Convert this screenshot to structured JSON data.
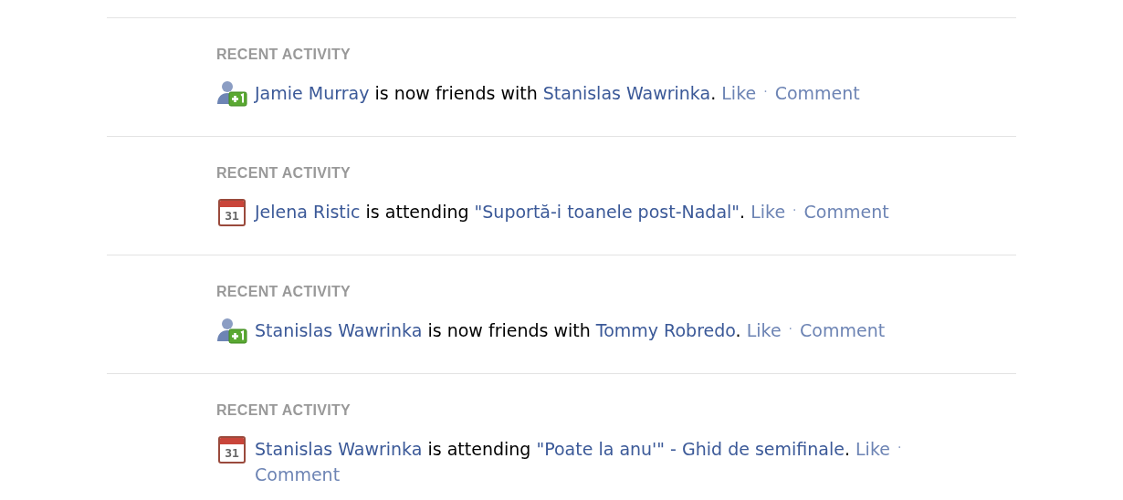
{
  "activities": [
    {
      "heading": "RECENT ACTIVITY",
      "kind": "friend",
      "parts": [
        {
          "text": "Jamie Murray",
          "kind": "link"
        },
        {
          "text": " is now friends with ",
          "kind": "text"
        },
        {
          "text": "Stanislas Wawrinka",
          "kind": "link"
        },
        {
          "text": ".",
          "kind": "text"
        }
      ],
      "actions": [
        "Like",
        "Comment"
      ],
      "separator": "·"
    },
    {
      "heading": "RECENT ACTIVITY",
      "kind": "event",
      "icon_label": "31",
      "parts": [
        {
          "text": "Jelena Ristic",
          "kind": "link"
        },
        {
          "text": " is attending ",
          "kind": "text"
        },
        {
          "text": "\"Suportă-i toanele post-Nadal\"",
          "kind": "link"
        },
        {
          "text": ".",
          "kind": "text"
        }
      ],
      "actions": [
        "Like",
        "Comment"
      ],
      "separator": "·"
    },
    {
      "heading": "RECENT ACTIVITY",
      "kind": "friend",
      "parts": [
        {
          "text": "Stanislas Wawrinka",
          "kind": "link"
        },
        {
          "text": " is now friends with ",
          "kind": "text"
        },
        {
          "text": "Tommy Robredo",
          "kind": "link"
        },
        {
          "text": ".",
          "kind": "text"
        }
      ],
      "actions": [
        "Like",
        "Comment"
      ],
      "separator": "·"
    },
    {
      "heading": "RECENT ACTIVITY",
      "kind": "event",
      "icon_label": "31",
      "parts": [
        {
          "text": "Stanislas Wawrinka",
          "kind": "link"
        },
        {
          "text": " is attending ",
          "kind": "text"
        },
        {
          "text": "\"Poate la anu'\" - Ghid de semifinale",
          "kind": "link"
        },
        {
          "text": ".",
          "kind": "text"
        }
      ],
      "actions": [
        "Like",
        "Comment"
      ],
      "separator": "·"
    }
  ]
}
